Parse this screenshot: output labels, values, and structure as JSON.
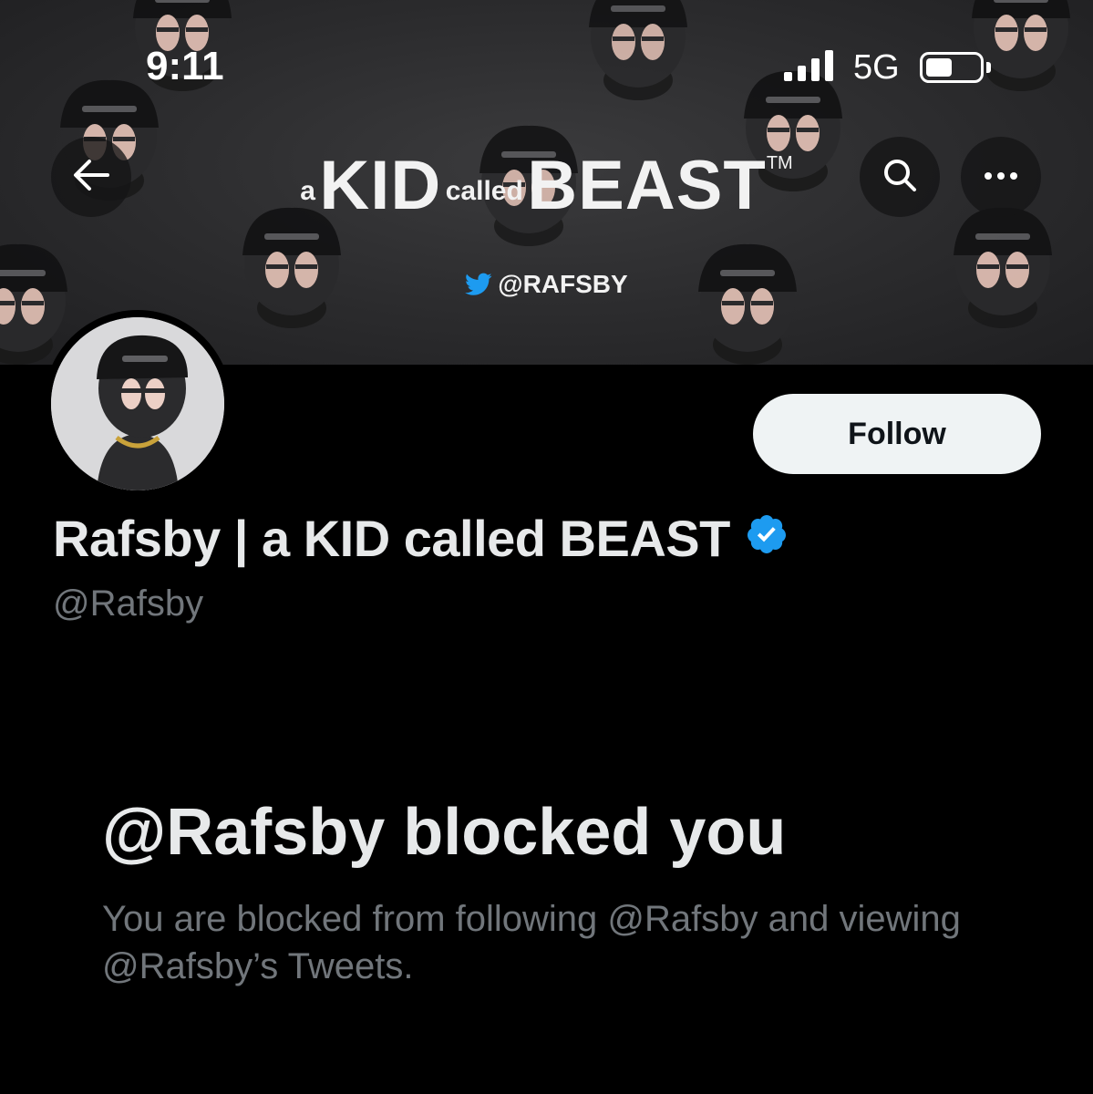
{
  "status_bar": {
    "time": "9:11",
    "network": "5G",
    "battery_level": 0.5
  },
  "banner": {
    "brand_prefix": "a",
    "brand_kid": "KID",
    "brand_called": "called",
    "brand_beast": "BEAST",
    "brand_tm": "TM",
    "handle": "@RAFSBY"
  },
  "header": {
    "back_icon": "arrow-left-icon",
    "search_icon": "search-icon",
    "more_icon": "more-horizontal-icon"
  },
  "profile": {
    "display_name": "Rafsby | a KID called BEAST",
    "handle": "@Rafsby",
    "verified": true,
    "verified_color": "#1d9bf0",
    "follow_label": "Follow"
  },
  "blocked": {
    "title": "@Rafsby blocked you",
    "description": "You are blocked from following @Rafsby and viewing @Rafsby’s Tweets."
  },
  "colors": {
    "background": "#000000",
    "text_primary": "#e7e9ea",
    "text_secondary": "#71767b",
    "twitter_blue": "#1d9bf0"
  }
}
